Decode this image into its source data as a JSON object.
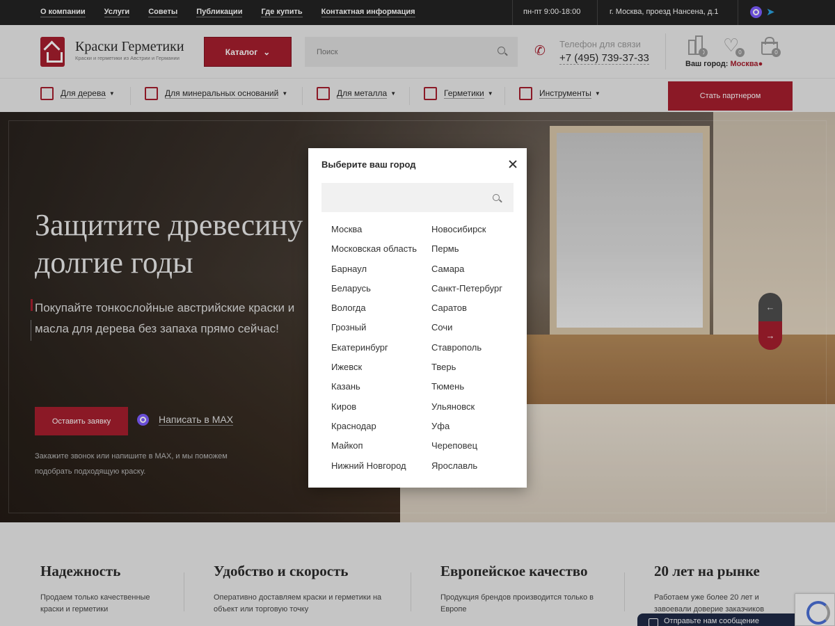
{
  "topbar": {
    "links": [
      "О компании",
      "Услуги",
      "Советы",
      "Публикации",
      "Где купить",
      "Контактная информация"
    ],
    "hours": "пн-пт 9:00-18:00",
    "address": "г. Москва, проезд Нансена, д.1",
    "icons": [
      "max-icon",
      "telegram-icon"
    ]
  },
  "header": {
    "logo_title": "Краски Герметики",
    "logo_subtitle": "Краски и герметики из Австрии и Германии",
    "catalog_label": "Каталог",
    "search_placeholder": "Поиск",
    "phone_label": "Телефон для связи",
    "phone_number": "+7 (495) 739-37-33",
    "compare_count": "0",
    "favorites_count": "0",
    "cart_count": "0",
    "city_label": "Ваш город:",
    "city_value": "Москва"
  },
  "nav": {
    "items": [
      {
        "label": "Для дерева",
        "icon": "wood-icon"
      },
      {
        "label": "Для минеральных оснований",
        "icon": "brick-icon"
      },
      {
        "label": "Для металла",
        "icon": "metal-icon"
      },
      {
        "label": "Герметики",
        "icon": "sealant-gun-icon"
      },
      {
        "label": "Инструменты",
        "icon": "brush-icon"
      }
    ],
    "partner_label": "Стать партнером"
  },
  "hero": {
    "title": "Защитите древесину на долгие годы",
    "lead": "Покупайте тонкослойные австрийские краски и масла для дерева без запаха прямо сейчас!",
    "order_label": "Оставить заявку",
    "max_label": "Написать в MAX",
    "note": "Закажите звонок или напишите в MAX, и мы поможем подобрать подходящую краску."
  },
  "features": [
    {
      "title": "Надежность",
      "text": "Продаем только качественные краски и герметики"
    },
    {
      "title": "Удобство и скорость",
      "text": "Оперативно доставляем краски и герметики на объект или торговую точку"
    },
    {
      "title": "Европейское качество",
      "text": "Продукция брендов производится только в Европе"
    },
    {
      "title": "20 лет на рынке",
      "text": "Работаем уже более 20 лет и завоевали доверие заказчиков"
    }
  ],
  "chat_label": "Отправьте нам сообщение",
  "modal": {
    "title": "Выберите ваш город",
    "search_value": "",
    "cities_col1": [
      "Москва",
      "Московская область",
      "Барнаул",
      "Беларусь",
      "Вологда",
      "Грозный",
      "Екатеринбург",
      "Ижевск",
      "Казань",
      "Киров",
      "Краснодар",
      "Майкоп",
      "Нижний Новгород"
    ],
    "cities_col2": [
      "Новосибирск",
      "Пермь",
      "Самара",
      "Санкт-Петербург",
      "Саратов",
      "Сочи",
      "Ставрополь",
      "Тверь",
      "Тюмень",
      "Ульяновск",
      "Уфа",
      "Череповец",
      "Ярославль"
    ]
  },
  "colors": {
    "brand": "#a61e2e",
    "topbar": "#232323",
    "header_bg": "#ebebeb"
  }
}
